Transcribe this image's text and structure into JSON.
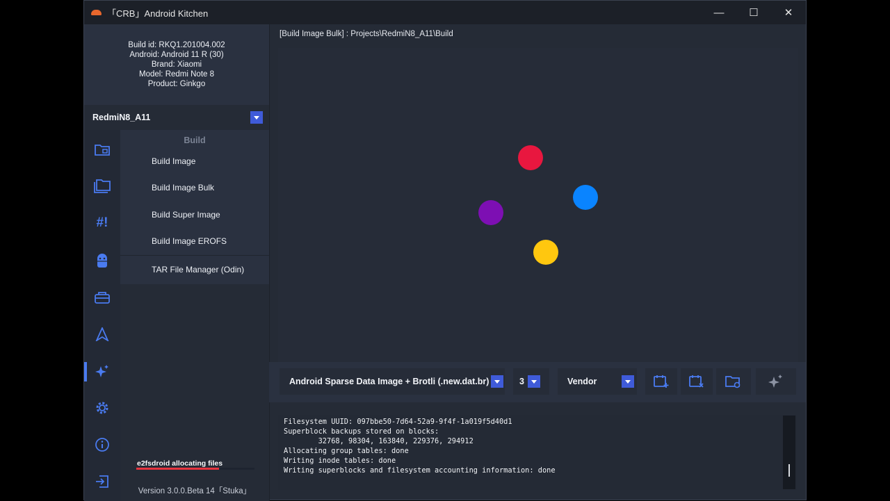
{
  "window": {
    "title": "「CRB」Android Kitchen"
  },
  "window_controls": {
    "minimize": "—",
    "maximize": "☐",
    "close": "✕"
  },
  "build_info": {
    "build_id": "Build id: RKQ1.201004.002",
    "android": "Android: Android 11 R (30)",
    "brand": "Brand: Xiaomi",
    "model": "Model: Redmi Note 8",
    "product": "Product: Ginkgo"
  },
  "project": {
    "selected": "RedmiN8_A11"
  },
  "nav_icons": [
    "folder-icon",
    "folders-icon",
    "script-icon",
    "android-icon",
    "toolbox-icon",
    "send-icon",
    "sparkles-icon",
    "gear-icon",
    "info-icon",
    "logout-icon"
  ],
  "menu": {
    "header": "Build",
    "items": [
      "Build Image",
      "Build Image Bulk",
      "Build Super Image",
      "Build Image EROFS",
      "TAR File Manager (Odin)"
    ]
  },
  "status": {
    "progress_label": "e2fsdroid allocating files",
    "progress_fraction": 0.7,
    "version": "Version 3.0.0.Beta 14「Stuka」"
  },
  "main": {
    "path": "[Build Image Bulk] : Projects\\RedmiN8_A11\\Build"
  },
  "loader_colors": [
    "#e8173f",
    "#0a84ff",
    "#ffc70f",
    "#7d0fb3"
  ],
  "toolbar": {
    "format": "Android Sparse Data Image + Brotli (.new.dat.br)",
    "level": "3",
    "partition": "Vendor",
    "buttons": [
      "calendar-add-icon",
      "calendar-remove-icon",
      "folder-open-icon",
      "sparkles-icon"
    ]
  },
  "console": {
    "lines": [
      "Filesystem UUID: 097bbe50-7d64-52a9-9f4f-1a019f5d40d1",
      "Superblock backups stored on blocks:",
      "        32768, 98304, 163840, 229376, 294912",
      "Allocating group tables: done",
      "Writing inode tables: done",
      "Writing superblocks and filesystem accounting information: done"
    ]
  }
}
